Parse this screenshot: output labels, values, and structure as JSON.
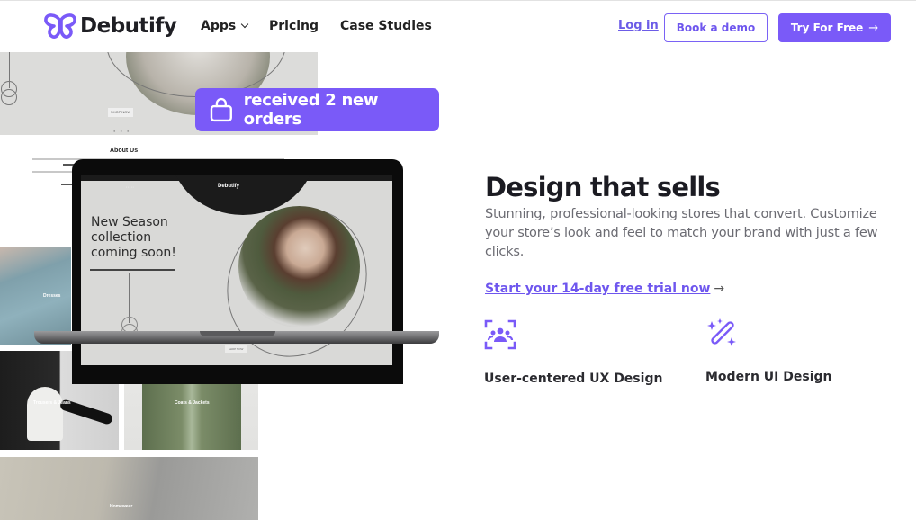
{
  "nav": {
    "brand": "Debutify",
    "items": [
      {
        "label": "Apps",
        "has_dropdown": true
      },
      {
        "label": "Pricing"
      },
      {
        "label": "Case Studies"
      }
    ],
    "login_label": "Log in",
    "demo_label": "Book a demo",
    "try_label": "Try For Free",
    "try_icon": "arrow-right-icon"
  },
  "colors": {
    "accent": "#7a5af8",
    "text_dark": "#1b1b22",
    "text_muted": "#6b6b72"
  },
  "notification": {
    "icon": "shopping-bag-icon",
    "text": "received 2 new orders"
  },
  "preview": {
    "hero_heading": "New Season collection coming soon!",
    "hero_lines": [
      "New Season",
      "collection",
      "coming soon!"
    ],
    "brand": "Debutify",
    "shop_button": "SHOP NOW",
    "about_title": "About Us",
    "categories": [
      "Dresses",
      "Trousers & Jeans",
      "Coats & Jackets",
      "Homewear"
    ]
  },
  "main": {
    "title": "Design that sells",
    "description": "Stunning, professional-looking stores that convert. Customize your store’s look and feel to match your brand with just a few clicks.",
    "cta_label": "Start your 14-day free trial now",
    "cta_icon": "arrow-right-icon",
    "features": [
      {
        "icon": "user-focus-icon",
        "label": "User-centered UX Design"
      },
      {
        "icon": "magic-wand-icon",
        "label": "Modern UI Design"
      }
    ]
  }
}
